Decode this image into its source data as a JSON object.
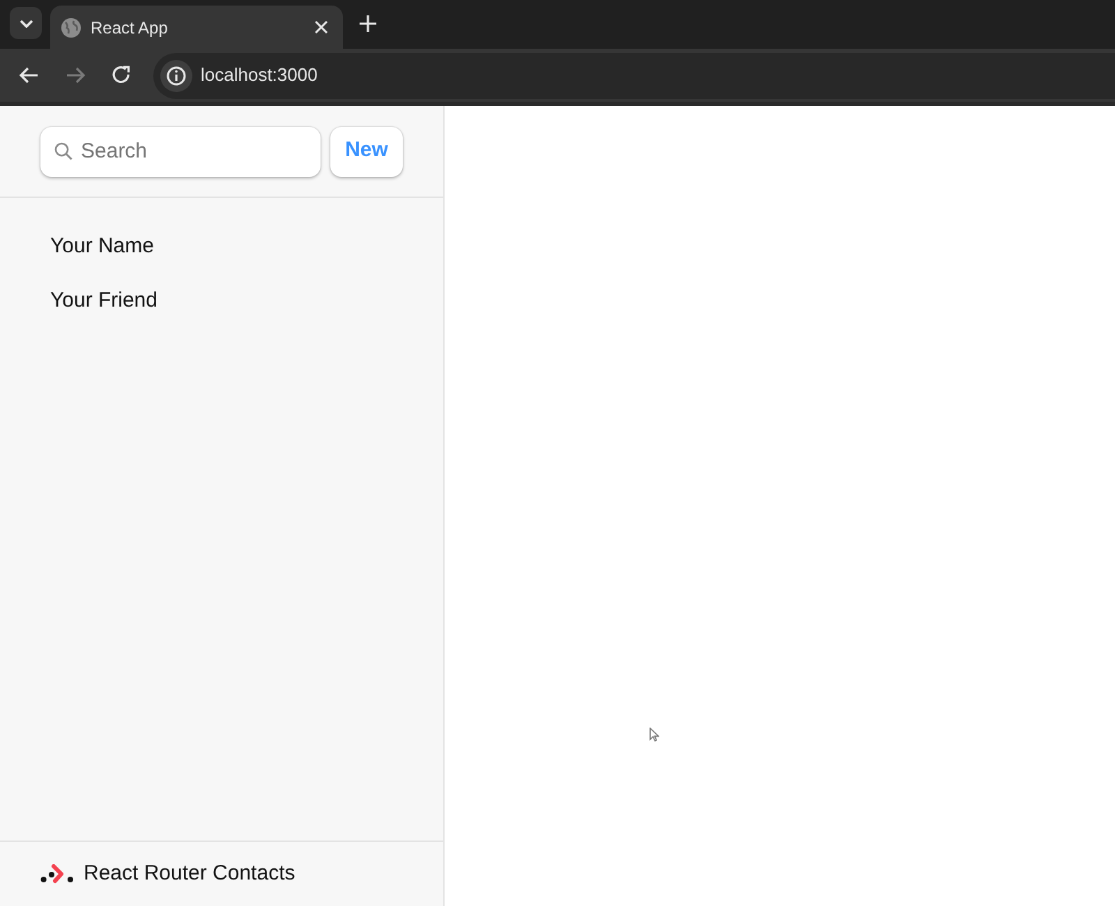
{
  "browser": {
    "tabs": [
      {
        "title": "React App",
        "selected": true
      }
    ],
    "nav_buttons": [
      {
        "kind": "back",
        "disabled": false
      },
      {
        "kind": "forward",
        "disabled": true
      },
      {
        "kind": "reload",
        "disabled": false
      }
    ],
    "address": "localhost:3000"
  },
  "sidebar": {
    "search": {
      "placeholder": "Search"
    },
    "new_button": "New",
    "contacts": [
      {
        "name": "Your Name"
      },
      {
        "name": "Your Friend"
      }
    ],
    "footer": "React Router Contacts"
  }
}
